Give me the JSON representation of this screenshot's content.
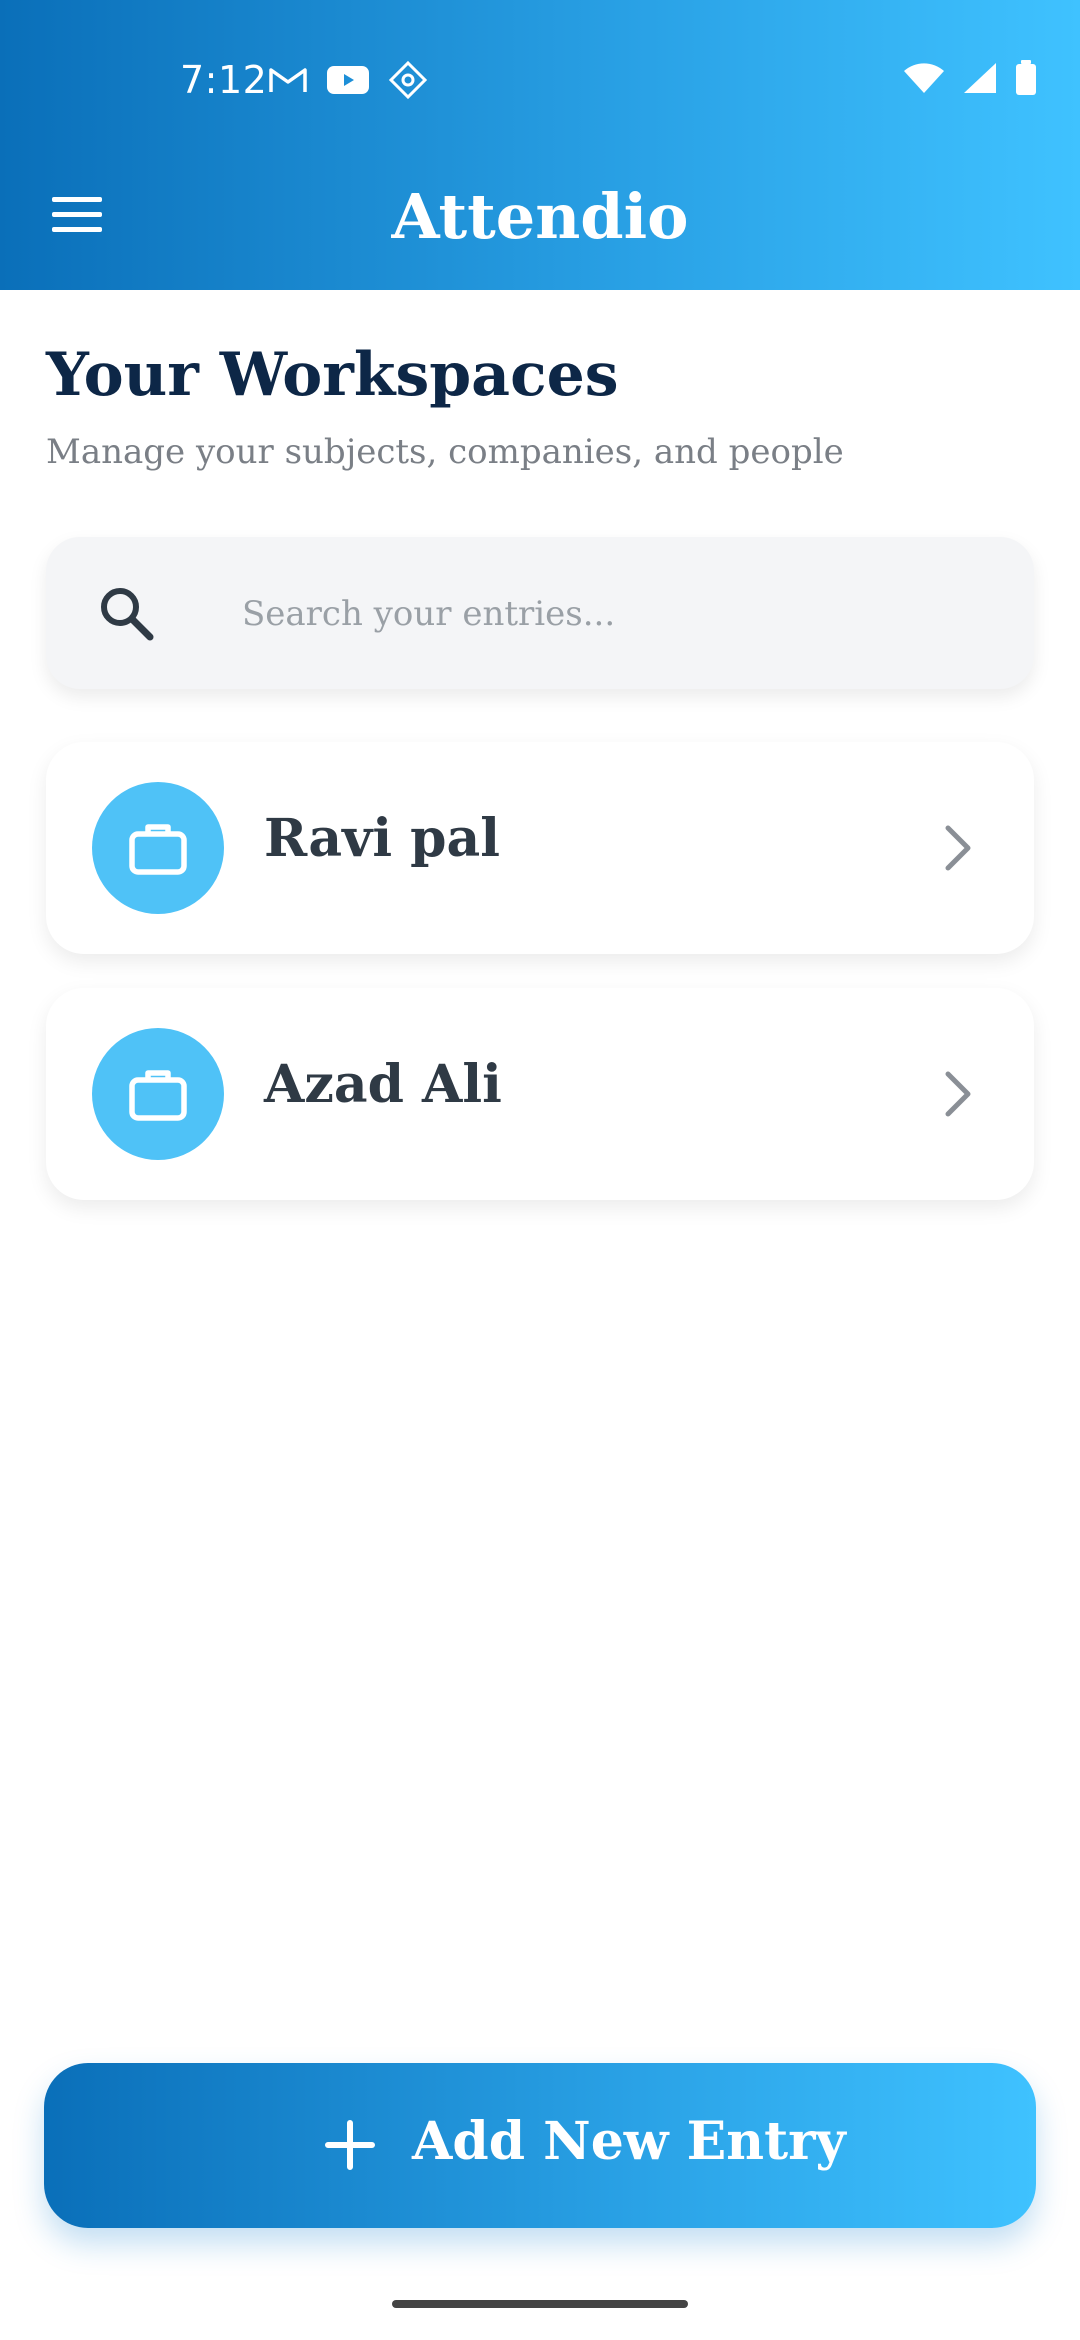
{
  "status_bar": {
    "time": "7:12",
    "icons_left": [
      "gmail-icon",
      "youtube-icon",
      "app-icon"
    ],
    "icons_right": [
      "wifi-icon",
      "signal-icon",
      "battery-icon"
    ]
  },
  "app_bar": {
    "title": "Attendio",
    "menu_icon": "menu-icon"
  },
  "page": {
    "title": "Your Workspaces",
    "subtitle": "Manage your subjects, companies, and people"
  },
  "search": {
    "placeholder": "Search your entries...",
    "value": ""
  },
  "workspaces": [
    {
      "label": "Ravi pal",
      "icon": "briefcase-icon"
    },
    {
      "label": "Azad Ali",
      "icon": "briefcase-icon"
    }
  ],
  "actions": {
    "add_label": "Add New Entry",
    "add_icon": "plus-icon"
  },
  "colors": {
    "gradient_start": "#0a6fb9",
    "gradient_end": "#3fc2ff",
    "title": "#0d2747",
    "avatar_bg": "#4fc2f7"
  }
}
